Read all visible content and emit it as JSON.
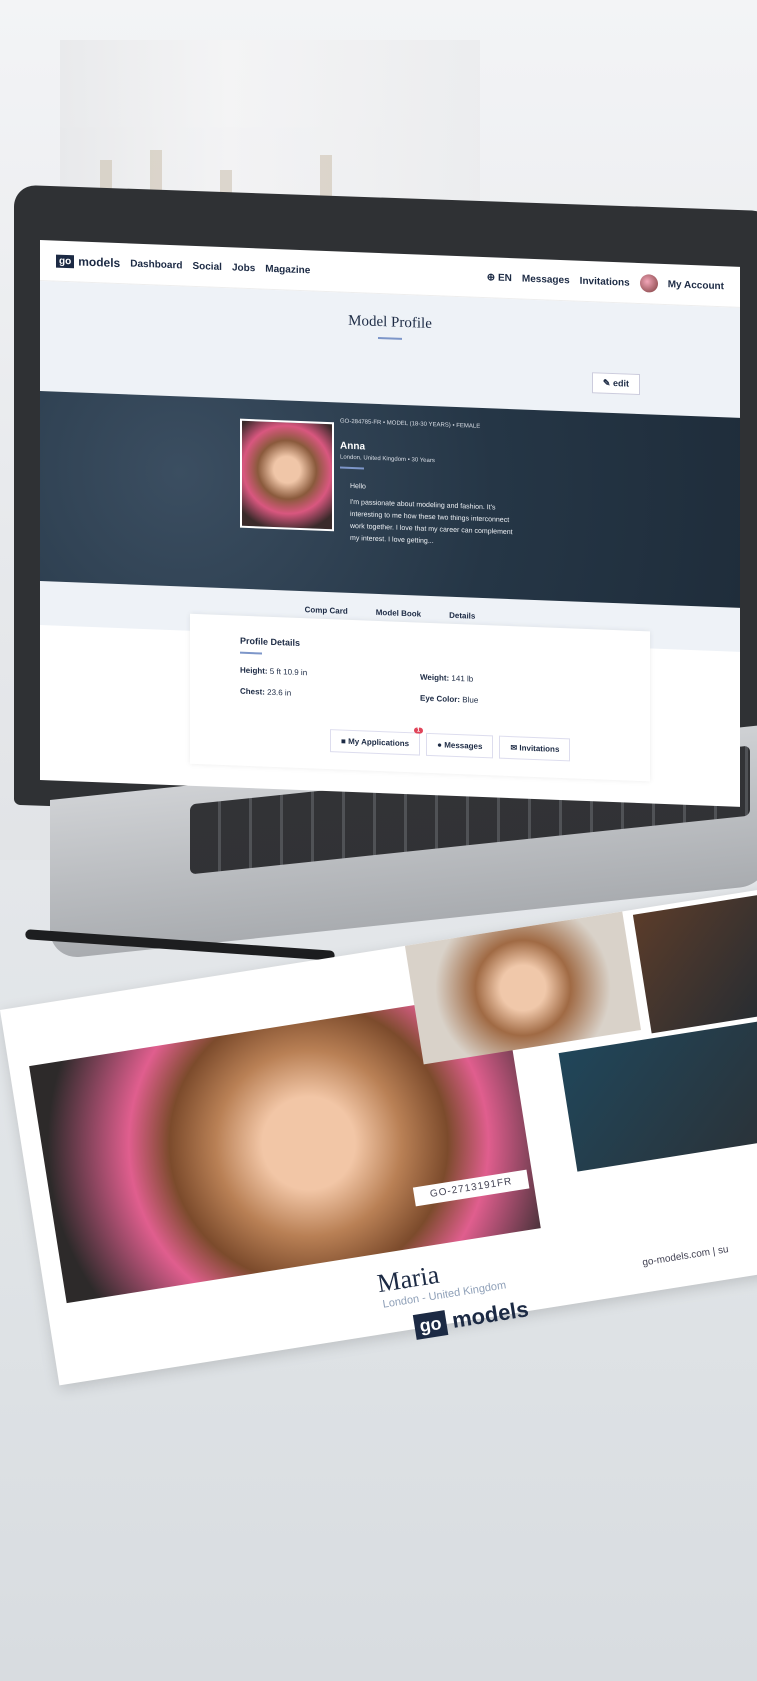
{
  "nav": {
    "logo_box": "go",
    "logo_text": "models",
    "links": [
      "Dashboard",
      "Social",
      "Jobs",
      "Magazine"
    ],
    "lang": "EN",
    "messages": "Messages",
    "invitations": "Invitations",
    "account": "My Account"
  },
  "page": {
    "title": "Model Profile",
    "edit": "edit"
  },
  "hero": {
    "id_line": "GO-284785-FR  •  MODEL (18-30 YEARS)  •  FEMALE",
    "name": "Anna",
    "location": "London, United Kingdom  •  30 Years",
    "greeting": "Hello",
    "bio": "I'm passionate about modeling and fashion. It's interesting to me how these two things interconnect work together. I love that my career can complement my interest. I love getting..."
  },
  "tabs": [
    "Comp Card",
    "Model Book",
    "Details"
  ],
  "details": {
    "heading": "Profile Details",
    "height_label": "Height:",
    "height_value": "5 ft 10.9 in",
    "weight_label": "Weight:",
    "weight_value": "141 lb",
    "chest_label": "Chest:",
    "chest_value": "23.6 in",
    "eye_label": "Eye Color:",
    "eye_value": "Blue"
  },
  "dock": {
    "applications": "My Applications",
    "applications_badge": "1",
    "messages": "Messages",
    "invitations": "Invitations"
  },
  "card": {
    "id": "GO-2713191FR",
    "name": "Maria",
    "location": "London - United Kingdom",
    "logo_box": "go",
    "logo_text": "models",
    "website": "go-models.com  |  su"
  }
}
